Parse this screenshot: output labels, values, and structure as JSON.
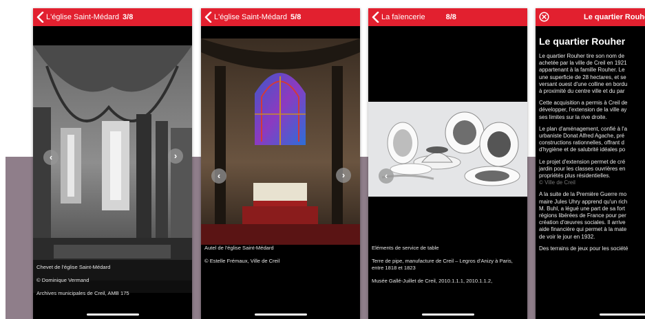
{
  "screens": [
    {
      "back_label": "L'église Saint-Médard",
      "counter": "3/8",
      "captions": [
        "Chevet de l'église Saint-Médard",
        "© Dominique Vermand",
        "Archives municipales de Creil, AMB 175"
      ]
    },
    {
      "back_label": "L'église Saint-Médard",
      "counter": "5/8",
      "captions": [
        "Autel de l'église Saint-Médard",
        "© Estelle Frémaux, Ville de Creil"
      ]
    },
    {
      "back_label": "La faïencerie",
      "counter": "8/8",
      "captions": [
        "Eléments de service de table",
        "Terre de pipe, manufacture de Creil – Legros d'Anizy à Paris, entre 1818 et 1823",
        "Musée Gallé-Juillet de Creil, 2010.1.1.1, 2010.1.1.2,"
      ]
    }
  ],
  "article": {
    "header_title": "Le quartier Rouher",
    "heading": "Le quartier Rouher",
    "paragraphs": [
      [
        "Le quartier Rouher tire son nom de",
        "achetée par la ville de Creil en 1921",
        "appartenant à la famille Rouher. Le",
        "une superficie de 28 hectares, et se",
        "versant ouest d'une colline en bordu",
        "à proximité du centre ville et du par"
      ],
      [
        "Cette acquisition a permis à Creil de",
        "développer, l'extension de la ville ay",
        "ses limites sur la rive droite."
      ],
      [
        "Le plan d'aménagement, confié à l'a",
        "urbaniste Donat Alfred Agache, pré",
        "constructions rationnelles, offrant d",
        "d'hygiène et de salubrité idéales po"
      ],
      [
        "Le projet d'extension permet de cré",
        "jardin pour les classes ouvrières en",
        "propriétés plus résidentielles."
      ],
      [
        "A la suite de la Première Guerre mo",
        "maire Jules Uhry apprend qu'un rich",
        "M. Buhl, a légué une part de sa fort",
        "régions libérées de France pour per",
        "création d'œuvres sociales. Il arrive",
        "aide financière qui permet à la mate",
        "de voir le jour en 1932."
      ],
      [
        "Des terrains de jeux pour les société"
      ]
    ],
    "faint_note": "© Ville de Creil"
  },
  "colors": {
    "header_red": "#e2202f",
    "background_band": "#8f7e8a"
  },
  "icons": {
    "back": "chevron-left-icon",
    "close": "close-circle-icon",
    "next": "chevron-right-icon"
  }
}
